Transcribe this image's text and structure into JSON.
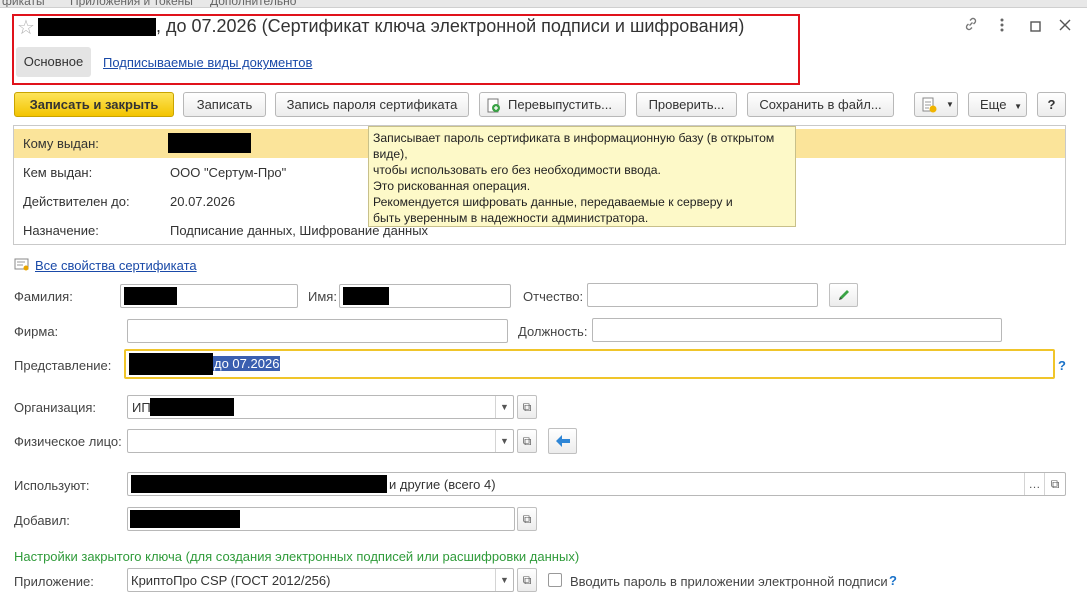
{
  "top_tabs": [
    "фикаты",
    "Приложения и токены",
    "Дополнительно"
  ],
  "title": ", до 07.2026 (Сертификат ключа электронной подписи и шифрования)",
  "tabs": {
    "main": "Основное",
    "doc_types": "Подписываемые виды документов"
  },
  "toolbar": {
    "save_close": "Записать и закрыть",
    "save": "Записать",
    "save_password": "Запись пароля сертификата",
    "reissue": "Перевыпустить...",
    "check": "Проверить...",
    "save_file": "Сохранить в файл...",
    "more": "Еще",
    "help": "?"
  },
  "info": {
    "issued_to_label": "Кому выдан:",
    "issued_by_label": "Кем выдан:",
    "issued_by_value": "ООО \"Сертум-Про\"",
    "valid_until_label": "Действителен до:",
    "valid_until_value": "20.07.2026",
    "purpose_label": "Назначение:",
    "purpose_value": "Подписание данных, Шифрование данных"
  },
  "tooltip": {
    "lines": [
      "Записывает пароль сертификата в информационную базу (в открытом",
      "виде),",
      "чтобы использовать его без необходимости ввода.",
      "Это рискованная операция.",
      "Рекомендуется шифровать данные, передаваемые к серверу и",
      "быть уверенным в надежности администратора."
    ]
  },
  "all_props_link": "Все свойства сертификата",
  "form": {
    "surname_label": "Фамилия:",
    "name_label": "Имя:",
    "patronymic_label": "Отчество:",
    "firm_label": "Фирма:",
    "position_label": "Должность:",
    "presentation_label": "Представление:",
    "presentation_value": "до 07.2026",
    "org_label": "Организация:",
    "org_value": "ИП",
    "person_label": "Физическое лицо:",
    "users_label": "Используют:",
    "users_value": "и другие (всего 4)",
    "added_label": "Добавил:",
    "private_key_section": "Настройки закрытого ключа (для создания электронных подписей или расшифровки данных)",
    "app_label": "Приложение:",
    "app_value": "КриптоПро CSP (ГОСТ 2012/256)",
    "enter_password_label": "Вводить пароль в приложении электронной подписи",
    "help": "?"
  },
  "colors": {
    "accent_yellow": "#f3c400",
    "highlight_row": "#fbe49a",
    "tooltip_bg": "#fdf9c8",
    "link": "#1a4aa8",
    "section_green": "#2f9b3a",
    "title_border": "#e0121b"
  }
}
